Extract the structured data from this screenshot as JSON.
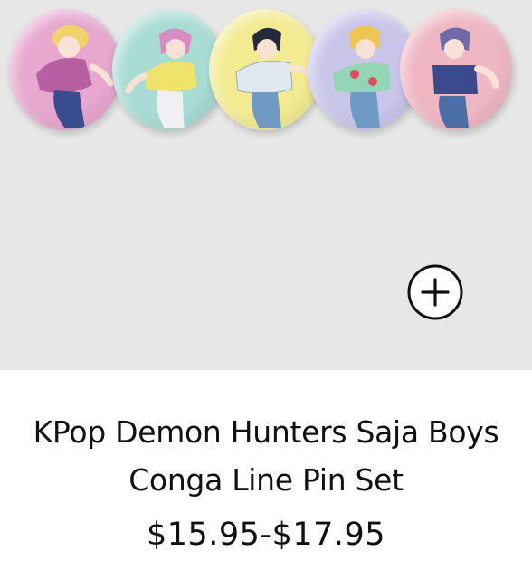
{
  "product": {
    "title": "KPop Demon Hunters Saja Boys Conga Line Pin Set",
    "price": "$15.95-$17.95"
  },
  "actions": {
    "add_icon": "plus-circle-icon"
  },
  "pins": [
    {
      "name": "pin-1",
      "color": "#e7a7cf",
      "accent": "#b85fa3",
      "hair": "#f0d36a"
    },
    {
      "name": "pin-2",
      "color": "#a9dcd4",
      "accent": "#efe36b",
      "hair": "#d88cc4"
    },
    {
      "name": "pin-3",
      "color": "#f3eb92",
      "accent": "#dfe9ef",
      "hair": "#232a3b"
    },
    {
      "name": "pin-4",
      "color": "#c9c6ea",
      "accent": "#93d6b5",
      "hair": "#f0c653"
    },
    {
      "name": "pin-5",
      "color": "#efb6c3",
      "accent": "#3b4a8c",
      "hair": "#6e6aa7"
    }
  ],
  "colors": {
    "image_bg": "#e7e7e7",
    "text": "#111111",
    "card_bg": "#ffffff"
  }
}
